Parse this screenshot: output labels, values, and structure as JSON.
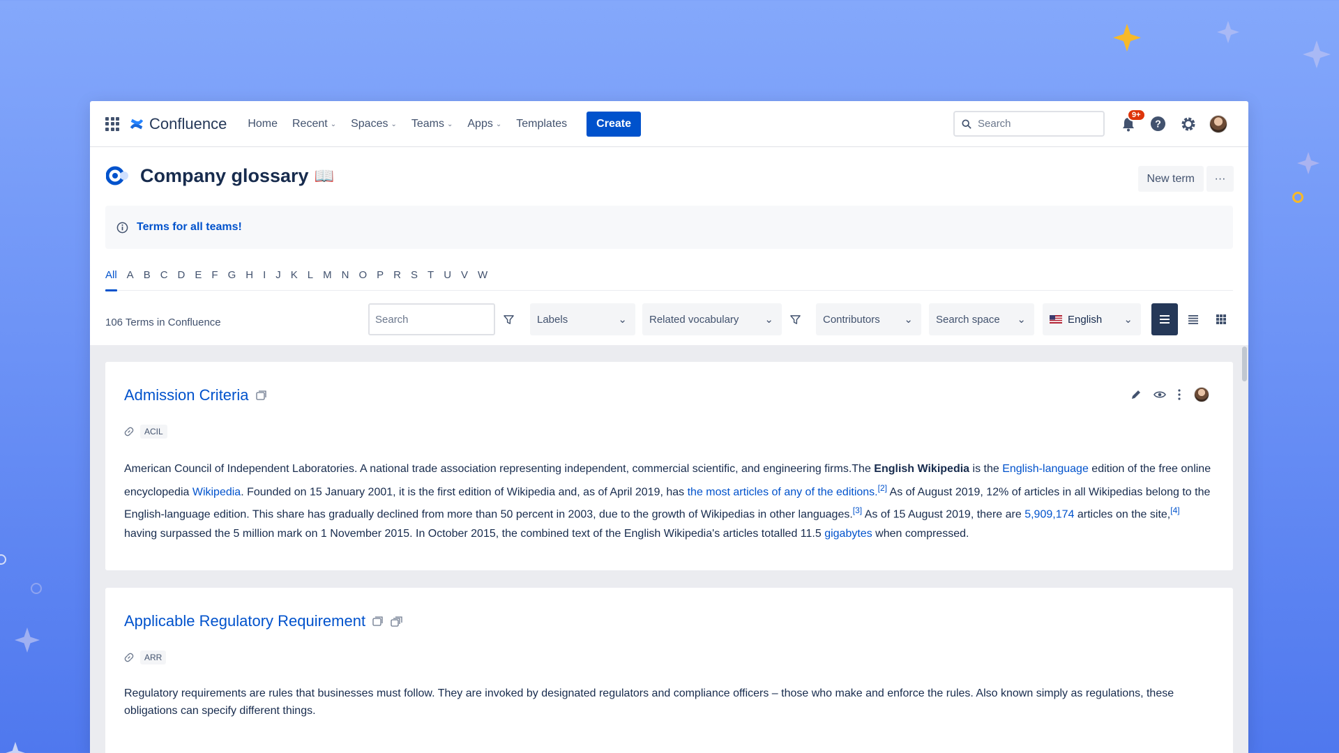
{
  "nav": {
    "app_name": "Confluence",
    "items": [
      {
        "label": "Home",
        "has_menu": false
      },
      {
        "label": "Recent",
        "has_menu": true
      },
      {
        "label": "Spaces",
        "has_menu": true
      },
      {
        "label": "Teams",
        "has_menu": true
      },
      {
        "label": "Apps",
        "has_menu": true
      },
      {
        "label": "Templates",
        "has_menu": false
      }
    ],
    "create_label": "Create",
    "search_placeholder": "Search",
    "notification_badge": "9+"
  },
  "page": {
    "title": "Company glossary",
    "title_emoji": "📖",
    "new_term_label": "New term",
    "more_label": "···",
    "info_text": "Terms for all teams!"
  },
  "alphabet": [
    "All",
    "A",
    "B",
    "C",
    "D",
    "E",
    "F",
    "G",
    "H",
    "I",
    "J",
    "K",
    "L",
    "M",
    "N",
    "O",
    "P",
    "R",
    "S",
    "T",
    "U",
    "V",
    "W"
  ],
  "filters": {
    "term_count": "106 Terms in Confluence",
    "search_placeholder": "Search",
    "labels": "Labels",
    "related_vocabulary": "Related vocabulary",
    "contributors": "Contributors",
    "search_space": "Search space",
    "language": "English"
  },
  "terms": [
    {
      "title": "Admission Criteria",
      "abbreviation": "ACIL",
      "body": {
        "t1": "American Council of Independent Laboratories. A national trade association representing independent, commercial scientific, and engineering firms.The ",
        "b1": "English Wikipedia",
        "t2": " is the ",
        "l1": "English-language",
        "t3": " edition of the free online encyclopedia ",
        "l2": "Wikipedia",
        "t4": ". Founded on 15 January 2001, it is the first edition of Wikipedia and, as of April 2019, has ",
        "l3": "the most articles of any of the editions.",
        "s1": "[2]",
        "t5": " As of August 2019, 12% of articles in all Wikipedias belong to the English-language edition. This share has gradually declined from more than 50 percent in 2003, due to the growth of Wikipedias in other languages.",
        "s2": "[3]",
        "t6": " As of 15 August 2019, there are ",
        "l4": "5,909,174",
        "t7": " articles on the site,",
        "s3": "[4]",
        "t8": " having surpassed the 5 million mark on 1 November 2015. In October 2015, the combined text of the English Wikipedia's articles totalled 11.5 ",
        "l5": "gigabytes",
        "t9": " when compressed."
      }
    },
    {
      "title": "Applicable Regulatory Requirement",
      "abbreviation": "ARR",
      "body": "Regulatory requirements are rules that businesses must follow. They are invoked by designated regulators and compliance officers – those who make and enforce the rules. Also known simply as regulations, these obligations can specify different things."
    }
  ],
  "colors": {
    "accent": "#0052cc",
    "text": "#172b4d",
    "badge": "#de350b",
    "background_gradient": [
      "#84a8fb",
      "#4f78ee"
    ]
  }
}
